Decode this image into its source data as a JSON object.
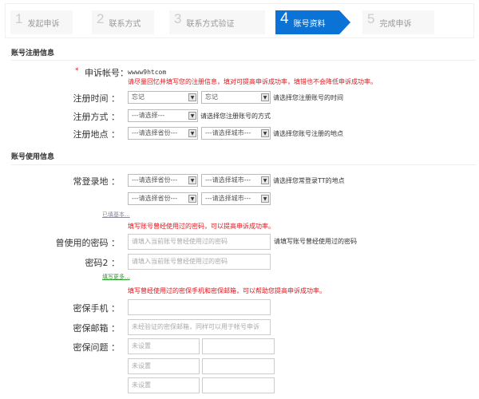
{
  "steps": [
    {
      "num": "1",
      "label": "发起申诉"
    },
    {
      "num": "2",
      "label": "联系方式"
    },
    {
      "num": "3",
      "label": "联系方式验证"
    },
    {
      "num": "4",
      "label": "账号资料"
    },
    {
      "num": "5",
      "label": "完成申诉"
    }
  ],
  "reg": {
    "title": "账号注册信息",
    "required_mark": "*",
    "account_label": "申诉帐号：",
    "account_value": "wwww9htcom",
    "red_tip": "请尽量回忆并填写您的注册信息，填对可提高申诉成功率，填错也不会降低申诉成功率。",
    "time": {
      "label": "注册时间 ：",
      "sel1": "忘记",
      "sel2": "忘记",
      "tip": "请选择您注册账号的时间"
    },
    "method": {
      "label": "注册方式 ：",
      "sel1": "---请选择---",
      "tip": "请选择您注册账号的方式"
    },
    "place": {
      "label": "注册地点 ：",
      "sel1": "---请选择省份---",
      "sel2": "---请选择城市---",
      "tip": "请选择您账号注册的地点"
    }
  },
  "use": {
    "title": "账号使用信息",
    "login": {
      "label": "常登录地 ：",
      "sel1": "---请选择省份---",
      "sel2": "---请选择城市---",
      "tip": "请选择您常登录TT的地点",
      "sel3": "---请选择省份---",
      "sel4": "---请选择城市---"
    },
    "basic_link": "已填基本...",
    "pwd_red": "填写账号曾经使用过的密码，可以提高申诉成功率。",
    "pwd": {
      "label": "曾使用的密码 ：",
      "placeholder": "请填入当前账号曾经使用过的密码",
      "tip": "请填写账号曾经使用过的密码"
    },
    "pwd2": {
      "label": "密码2 ：",
      "placeholder": "请填入当前账号曾经使用过的密码"
    },
    "more_link": "填写更多...",
    "sec_red": "填写曾经使用过的密保手机和密保邮箱，可以帮助您提高申诉成功率。",
    "phone": {
      "label": "密保手机 ：",
      "placeholder": ""
    },
    "email": {
      "label": "密保邮箱 ：",
      "placeholder": "未经验证的密保邮箱，同样可以用于帐号申诉"
    },
    "question": {
      "label": "密保问题 ：",
      "placeholders": [
        "未设置",
        "未设置",
        "未设置"
      ]
    }
  }
}
